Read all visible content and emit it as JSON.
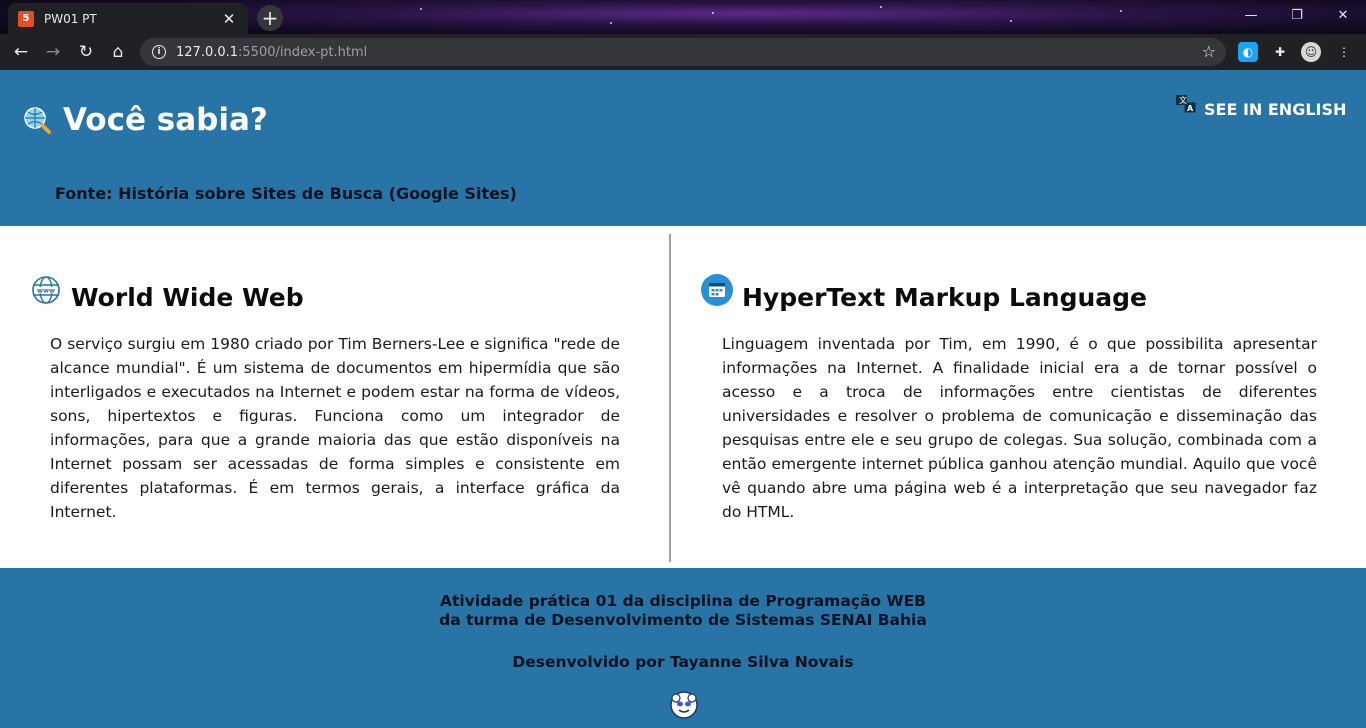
{
  "browser": {
    "tab_title": "PW01 PT",
    "tab_favicon": "html5-icon",
    "url_host": "127.0.0.1",
    "url_rest": ":5500/index-pt.html",
    "window_controls": [
      "minimize-icon",
      "restore-icon",
      "close-icon"
    ]
  },
  "header": {
    "title": "Você sabia?",
    "icon": "magnifier-globe-icon",
    "language_link": "SEE IN ENGLISH",
    "source_label": "Fonte:",
    "source_link": "História sobre Sites de Busca (Google Sites)",
    "background_color": "#2874a6"
  },
  "sections": [
    {
      "icon": "www-globe-icon",
      "title": "World Wide Web",
      "text": "O serviço surgiu em 1980 criado por Tim Berners-Lee e significa \"rede de alcance mundial\". É um sistema de documentos em hipermídia que são interligados e executados na Internet e podem estar na forma de vídeos, sons, hipertextos e figuras. Funciona como um integrador de informações, para que a grande maioria das que estão disponíveis na Internet possam ser acessadas de forma simples e consistente em diferentes plataformas. É em termos gerais, a interface gráfica da Internet."
    },
    {
      "icon": "browser-window-icon",
      "title": "HyperText Markup Language",
      "text": "Linguagem inventada por Tim, em 1990, é o que possibilita apresentar informações na Internet. A finalidade inicial era a de tornar possível o acesso e a troca de informações entre cientistas de diferentes universidades e resolver o problema de comunicação e disseminação das pesquisas entre ele e seu grupo de colegas. Sua solução, combinada com a então emergente internet pública ganhou atenção mundial. Aquilo que você vê quando abre uma página web é a interpretação que seu navegador faz do HTML."
    }
  ],
  "footer": {
    "line1": "Atividade prática 01 da disciplina de Programação WEB",
    "line2": "da turma de Desenvolvimento de Sistemas SENAI Bahia",
    "credit": "Desenvolvido por Tayanne Silva Novais",
    "logo": "smiley-avatar-icon"
  }
}
